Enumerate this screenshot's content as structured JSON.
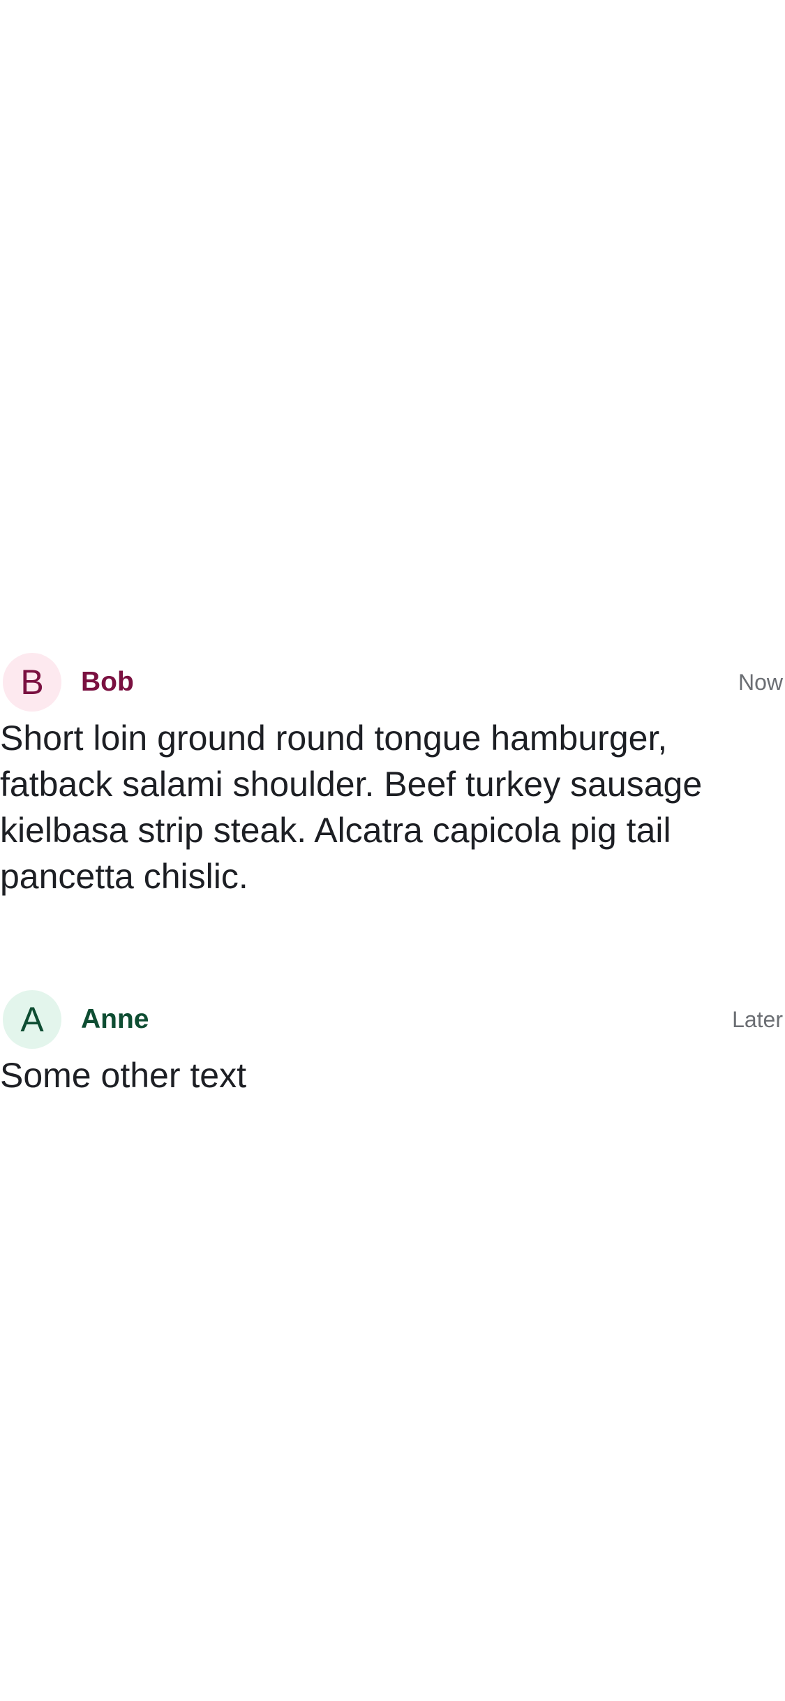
{
  "comments": [
    {
      "avatar_letter": "B",
      "author": "Bob",
      "time": "Now",
      "text": "Short loin ground round tongue hamburger, fatback salami shoulder. Beef turkey sausage kielbasa strip steak. Alcatra capicola pig tail pancetta chislic.",
      "colors": {
        "avatar_bg": "#fde9ef",
        "accent": "#7a1040"
      }
    },
    {
      "avatar_letter": "A",
      "author": "Anne",
      "time": "Later",
      "text": "Some other text",
      "colors": {
        "avatar_bg": "#e3f5ec",
        "accent": "#0e4d32"
      }
    }
  ]
}
